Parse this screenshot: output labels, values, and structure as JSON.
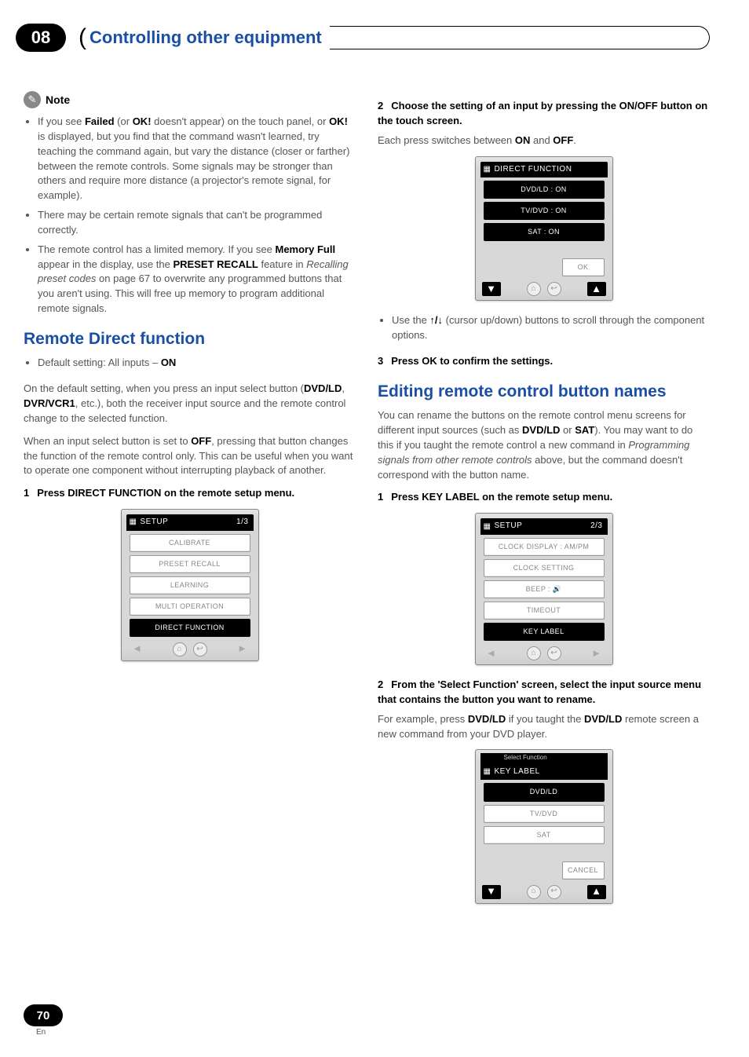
{
  "chapter": "08",
  "header_title": "Controlling other equipment",
  "left": {
    "note_label": "Note",
    "bullet1_pre": "If you see ",
    "bullet1_b1": "Failed",
    "bullet1_mid1": " (or ",
    "bullet1_b2": "OK!",
    "bullet1_mid2": " doesn't appear) on the touch panel, or ",
    "bullet1_b3": "OK!",
    "bullet1_tail": " is displayed, but you find that the command wasn't learned, try teaching the command again, but vary the distance (closer or farther) between the remote controls. Some signals may be stronger than others and require more distance (a projector's remote signal, for example).",
    "bullet2": "There may be certain remote signals that can't be programmed correctly.",
    "bullet3_pre": "The remote control has a limited memory. If you see ",
    "bullet3_b1": "Memory Full",
    "bullet3_mid1": " appear in the display, use the ",
    "bullet3_b2": "PRESET RECALL",
    "bullet3_mid2": " feature in ",
    "bullet3_em": "Recalling preset codes",
    "bullet3_tail": " on page 67 to overwrite any programmed buttons that you aren't using. This will free up memory to program additional remote signals.",
    "section_title": "Remote Direct function",
    "default_pre": "Default setting: All inputs – ",
    "default_b": "ON",
    "p1_pre": "On the default setting, when you press an input select button (",
    "p1_b1": "DVD/LD",
    "p1_sep1": ", ",
    "p1_b2": "DVR/VCR1",
    "p1_tail": ", etc.), both the receiver input source and the remote control change to the selected function.",
    "p2_pre": "When an input select button is set to ",
    "p2_b": "OFF",
    "p2_tail": ", pressing that button changes the function of the remote control only. This can be useful when you want to operate one component without interrupting playback of another.",
    "step1_num": "1",
    "step1_text": "Press DIRECT FUNCTION on the remote setup menu.",
    "screen1": {
      "title": "SETUP",
      "page": "1/3",
      "items": [
        "CALIBRATE",
        "PRESET RECALL",
        "LEARNING",
        "MULTI OPERATION",
        "DIRECT FUNCTION"
      ]
    }
  },
  "right": {
    "step2_num": "2",
    "step2_text": "Choose the setting of an input by pressing the ON/OFF button on the touch screen.",
    "step2_sub_pre": "Each press switches between ",
    "step2_sub_b1": "ON",
    "step2_sub_mid": " and ",
    "step2_sub_b2": "OFF",
    "step2_sub_tail": ".",
    "screen2": {
      "title": "DIRECT FUNCTION",
      "items": [
        "DVD/LD : ON",
        "TV/DVD : ON",
        "SAT : ON"
      ],
      "ok": "OK"
    },
    "bullet_nav_pre": "Use the ",
    "bullet_nav_arrows": "↑/↓",
    "bullet_nav_tail": " (cursor up/down) buttons to scroll through the component options.",
    "step3_num": "3",
    "step3_text": "Press OK to confirm the settings.",
    "section_title": "Editing remote control button names",
    "intro_pre": "You can rename the buttons on the remote control menu screens for different input sources (such as ",
    "intro_b1": "DVD/LD",
    "intro_mid1": " or ",
    "intro_b2": "SAT",
    "intro_mid2": "). You may want to do this if you taught the remote control a new command in ",
    "intro_em": "Programming signals from other remote controls",
    "intro_tail": " above, but the command doesn't correspond with the button name.",
    "stepA_num": "1",
    "stepA_text": "Press KEY LABEL on the remote setup menu.",
    "screen3": {
      "title": "SETUP",
      "page": "2/3",
      "items": [
        "CLOCK DISPLAY : AM/PM",
        "CLOCK SETTING",
        "BEEP : 🔊",
        "TIMEOUT",
        "KEY LABEL"
      ]
    },
    "stepB_num": "2",
    "stepB_text": "From the 'Select Function' screen, select the input source menu that contains the button you want to rename.",
    "stepB_sub_pre": "For example, press ",
    "stepB_sub_b1": "DVD/LD",
    "stepB_sub_mid": " if you taught the ",
    "stepB_sub_b2": "DVD/LD",
    "stepB_sub_tail": " remote screen a new command from your DVD player.",
    "screen4": {
      "subtitle": "Select Function",
      "title": "KEY LABEL",
      "items": [
        "DVD/LD",
        "TV/DVD",
        "SAT"
      ],
      "cancel": "CANCEL"
    }
  },
  "footer": {
    "page_num": "70",
    "lang": "En"
  }
}
